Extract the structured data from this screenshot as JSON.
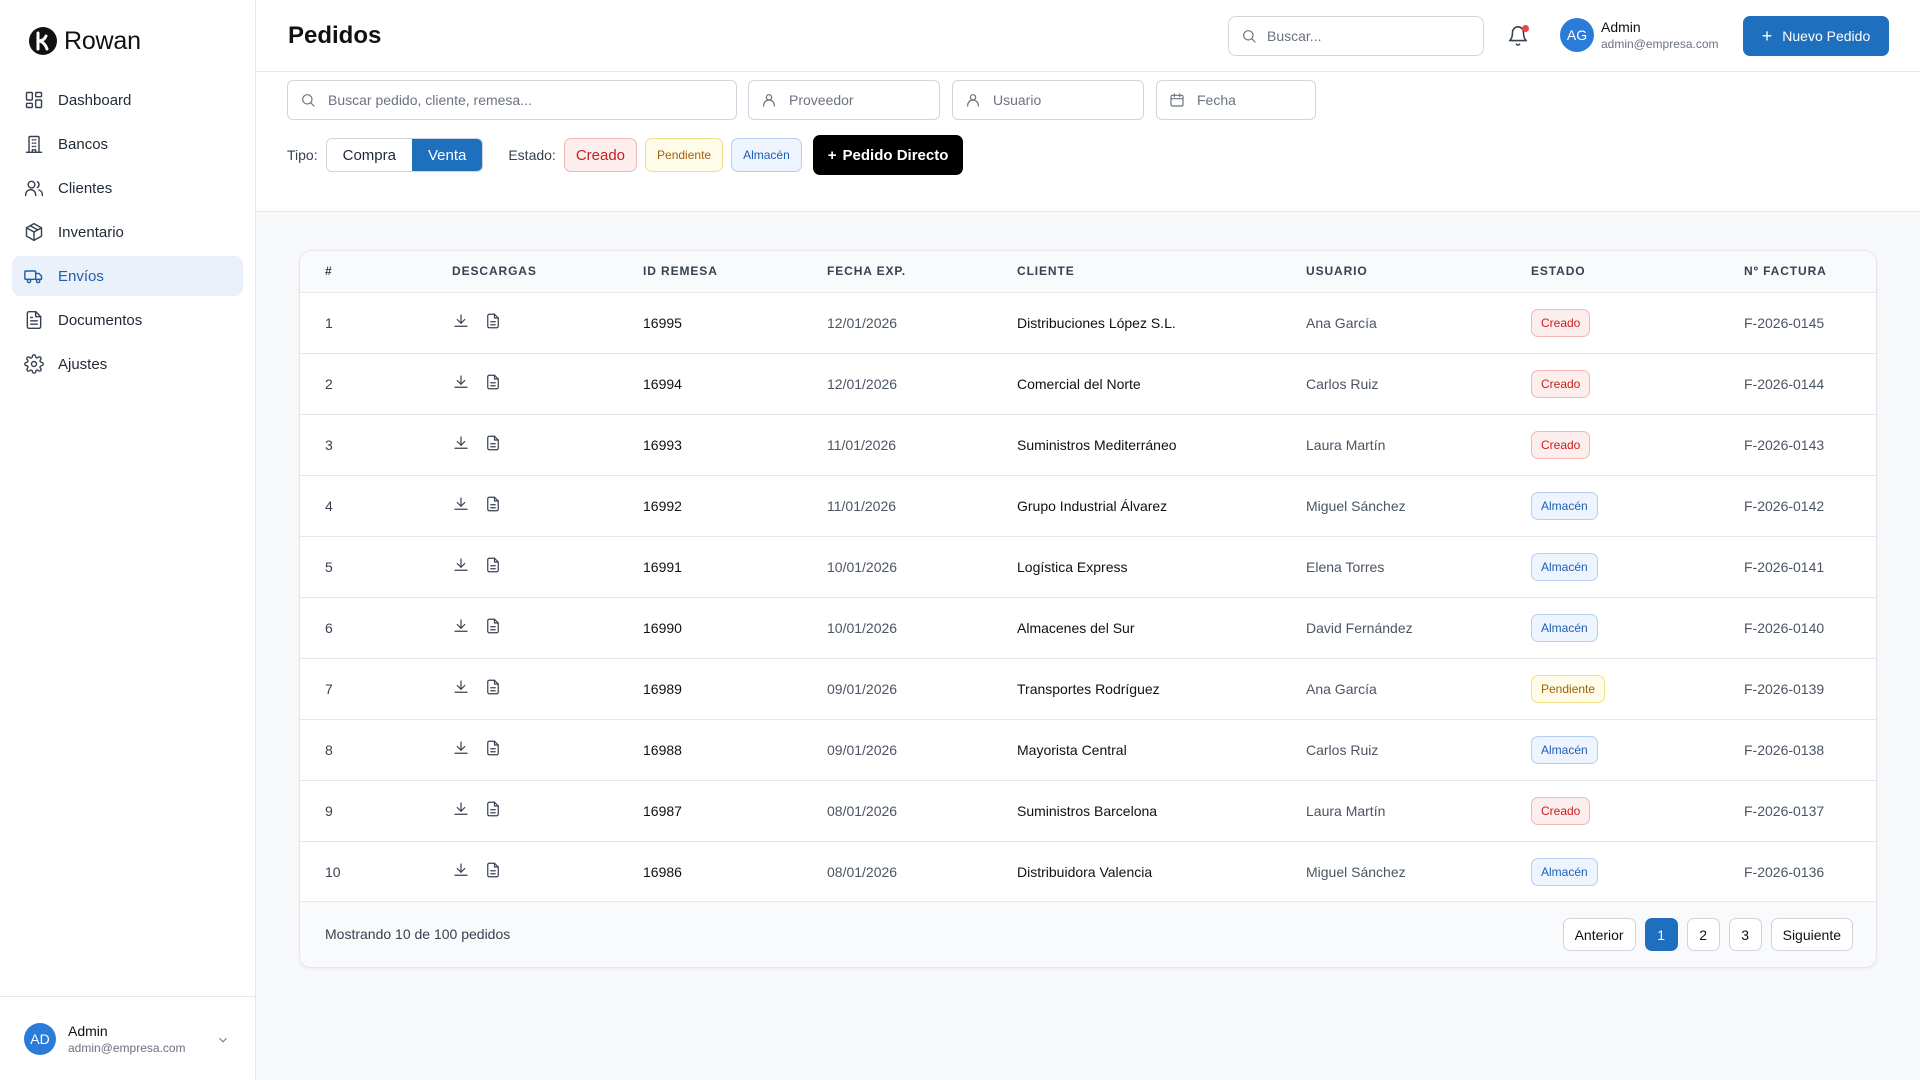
{
  "brand": {
    "name": "Rowan"
  },
  "sidebar": {
    "items": [
      {
        "label": "Dashboard",
        "icon": "dashboard-icon"
      },
      {
        "label": "Bancos",
        "icon": "bank-icon"
      },
      {
        "label": "Clientes",
        "icon": "users-icon"
      },
      {
        "label": "Inventario",
        "icon": "package-icon"
      },
      {
        "label": "Envíos",
        "icon": "truck-icon",
        "active": true
      },
      {
        "label": "Documentos",
        "icon": "document-icon"
      },
      {
        "label": "Ajustes",
        "icon": "gear-icon"
      }
    ],
    "user": {
      "initials": "AD",
      "name": "Admin",
      "email": "admin@empresa.com"
    }
  },
  "header": {
    "title": "Pedidos",
    "search_placeholder": "Buscar...",
    "user": {
      "initials": "AG",
      "name": "Admin",
      "email": "admin@empresa.com"
    },
    "new_order_label": "Nuevo Pedido"
  },
  "filters": {
    "search_placeholder": "Buscar pedido, cliente, remesa...",
    "provider_placeholder": "Proveedor",
    "user_placeholder": "Usuario",
    "date_placeholder": "Fecha",
    "type_label": "Tipo:",
    "type_options": [
      "Compra",
      "Venta"
    ],
    "type_selected": "Venta",
    "status_label": "Estado:",
    "status_chips": [
      "Creado",
      "Pendiente",
      "Almacén"
    ],
    "direct_order_label": "Pedido Directo"
  },
  "table": {
    "columns": [
      "#",
      "DESCARGAS",
      "ID REMESA",
      "FECHA EXP.",
      "CLIENTE",
      "USUARIO",
      "ESTADO",
      "Nº FACTURA"
    ],
    "rows": [
      {
        "n": "1",
        "id": "16995",
        "fecha": "12/01/2026",
        "cliente": "Distribuciones López S.L.",
        "usuario": "Ana García",
        "estado": "Creado",
        "factura": "F-2026-0145"
      },
      {
        "n": "2",
        "id": "16994",
        "fecha": "12/01/2026",
        "cliente": "Comercial del Norte",
        "usuario": "Carlos Ruiz",
        "estado": "Creado",
        "factura": "F-2026-0144"
      },
      {
        "n": "3",
        "id": "16993",
        "fecha": "11/01/2026",
        "cliente": "Suministros Mediterráneo",
        "usuario": "Laura Martín",
        "estado": "Creado",
        "factura": "F-2026-0143"
      },
      {
        "n": "4",
        "id": "16992",
        "fecha": "11/01/2026",
        "cliente": "Grupo Industrial Álvarez",
        "usuario": "Miguel Sánchez",
        "estado": "Almacén",
        "factura": "F-2026-0142"
      },
      {
        "n": "5",
        "id": "16991",
        "fecha": "10/01/2026",
        "cliente": "Logística Express",
        "usuario": "Elena Torres",
        "estado": "Almacén",
        "factura": "F-2026-0141"
      },
      {
        "n": "6",
        "id": "16990",
        "fecha": "10/01/2026",
        "cliente": "Almacenes del Sur",
        "usuario": "David Fernández",
        "estado": "Almacén",
        "factura": "F-2026-0140"
      },
      {
        "n": "7",
        "id": "16989",
        "fecha": "09/01/2026",
        "cliente": "Transportes Rodríguez",
        "usuario": "Ana García",
        "estado": "Pendiente",
        "factura": "F-2026-0139"
      },
      {
        "n": "8",
        "id": "16988",
        "fecha": "09/01/2026",
        "cliente": "Mayorista Central",
        "usuario": "Carlos Ruiz",
        "estado": "Almacén",
        "factura": "F-2026-0138"
      },
      {
        "n": "9",
        "id": "16987",
        "fecha": "08/01/2026",
        "cliente": "Suministros Barcelona",
        "usuario": "Laura Martín",
        "estado": "Creado",
        "factura": "F-2026-0137"
      },
      {
        "n": "10",
        "id": "16986",
        "fecha": "08/01/2026",
        "cliente": "Distribuidora Valencia",
        "usuario": "Miguel Sánchez",
        "estado": "Almacén",
        "factura": "F-2026-0136"
      }
    ],
    "footer_text": "Mostrando 10 de 100 pedidos",
    "pagination": {
      "prev": "Anterior",
      "pages": [
        "1",
        "2",
        "3"
      ],
      "current": "1",
      "next": "Siguiente"
    }
  },
  "colors": {
    "accent": "#1f6fbf",
    "active_nav_bg": "#eaf1fb",
    "creado": "#c81e1e",
    "almacen": "#1e5fb4",
    "pendiente": "#a16207"
  }
}
